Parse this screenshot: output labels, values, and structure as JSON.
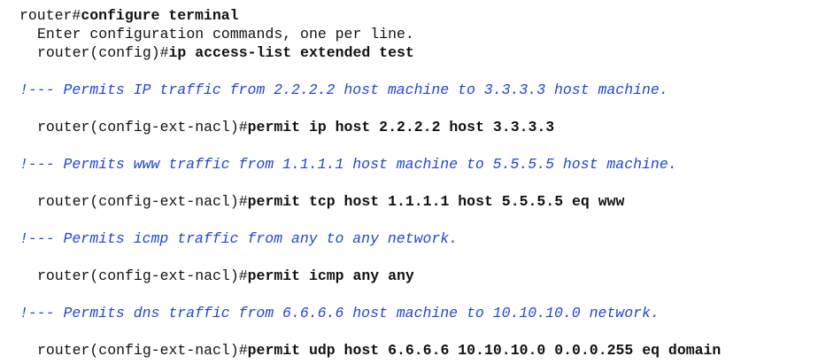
{
  "lines": [
    {
      "prompt": "router#",
      "command": "configure terminal"
    },
    {
      "text": "Enter configuration commands, one per line."
    },
    {
      "prompt": "router(config)#",
      "command": "ip access-list extended test"
    },
    {
      "comment": "!--- Permits IP traffic from 2.2.2.2 host machine to 3.3.3.3 host machine."
    },
    {
      "prompt": "router(config-ext-nacl)#",
      "command": "permit ip host 2.2.2.2 host 3.3.3.3"
    },
    {
      "comment": "!--- Permits www traffic from 1.1.1.1 host machine to 5.5.5.5 host machine."
    },
    {
      "prompt": "router(config-ext-nacl)#",
      "command": "permit tcp host 1.1.1.1 host 5.5.5.5 eq www"
    },
    {
      "comment": "!--- Permits icmp traffic from any to any network."
    },
    {
      "prompt": "router(config-ext-nacl)#",
      "command": "permit icmp any any"
    },
    {
      "comment": "!--- Permits dns traffic from 6.6.6.6 host machine to 10.10.10.0 network."
    },
    {
      "prompt": "router(config-ext-nacl)#",
      "command": "permit udp host 6.6.6.6 10.10.10.0 0.0.0.255 eq domain"
    }
  ],
  "colors": {
    "comment": "#1f47d6",
    "text": "#111111"
  }
}
